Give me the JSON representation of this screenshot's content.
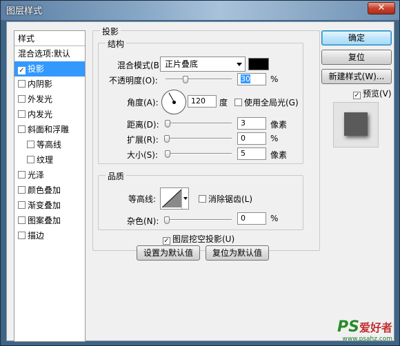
{
  "window": {
    "title": "图层样式",
    "close_label": "✕"
  },
  "sidebar": {
    "header": "样式",
    "blend_options": "混合选项:默认",
    "items": [
      {
        "label": "投影",
        "checked": true,
        "selected": true
      },
      {
        "label": "内阴影",
        "checked": false
      },
      {
        "label": "外发光",
        "checked": false
      },
      {
        "label": "内发光",
        "checked": false
      },
      {
        "label": "斜面和浮雕",
        "checked": false
      },
      {
        "label": "等高线",
        "checked": false,
        "indent": true
      },
      {
        "label": "纹理",
        "checked": false,
        "indent": true
      },
      {
        "label": "光泽",
        "checked": false
      },
      {
        "label": "颜色叠加",
        "checked": false
      },
      {
        "label": "渐变叠加",
        "checked": false
      },
      {
        "label": "图案叠加",
        "checked": false
      },
      {
        "label": "描边",
        "checked": false
      }
    ]
  },
  "drop_shadow": {
    "group_title": "投影",
    "structure": {
      "title": "结构",
      "blend_mode_label": "混合模式(B):",
      "blend_mode_value": "正片叠底",
      "shadow_color": "#000000",
      "opacity_label": "不透明度(O):",
      "opacity_value": "30",
      "opacity_unit": "%",
      "angle_label": "角度(A):",
      "angle_value": "120",
      "angle_unit": "度",
      "use_global_light_label": "使用全局光(G)",
      "use_global_light_checked": false,
      "distance_label": "距离(D):",
      "distance_value": "3",
      "distance_unit": "像素",
      "spread_label": "扩展(R):",
      "spread_value": "0",
      "spread_unit": "%",
      "size_label": "大小(S):",
      "size_value": "5",
      "size_unit": "像素"
    },
    "quality": {
      "title": "品质",
      "contour_label": "等高线:",
      "anti_aliased_label": "消除锯齿(L)",
      "anti_aliased_checked": false,
      "noise_label": "杂色(N):",
      "noise_value": "0",
      "noise_unit": "%"
    },
    "knockout_label": "图层挖空投影(U)",
    "knockout_checked": true,
    "make_default_label": "设置为默认值",
    "reset_default_label": "复位为默认值"
  },
  "buttons": {
    "ok": "确定",
    "reset": "复位",
    "new_style": "新建样式(W)...",
    "preview_label": "预览(V)",
    "preview_checked": true
  },
  "watermark": {
    "brand": "PS",
    "brand_text": "爱好者",
    "url": "www.psahz.com"
  }
}
